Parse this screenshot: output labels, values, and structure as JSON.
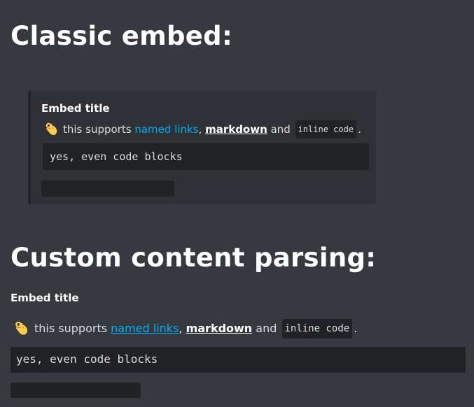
{
  "sections": {
    "classic_heading": "Classic embed:",
    "custom_heading": "Custom content parsing:"
  },
  "embed": {
    "title": "Embed title",
    "emoji_icon": "ok-hand-icon",
    "desc_prefix": "this supports ",
    "link_text": "named links",
    "comma": ",",
    "bold_text": "markdown",
    "and_text": " and ",
    "inline_code": "inline code",
    "period": ".",
    "code_block": "yes, even code blocks"
  },
  "custom": {
    "title": "Embed title",
    "emoji_icon": "ok-hand-icon",
    "desc_prefix": "this supports ",
    "link_text": "named links",
    "comma": ",",
    "bold_text": "markdown",
    "and_text": " and ",
    "inline_code": "inline code",
    "period": ".",
    "code_block": "yes, even code blocks"
  },
  "colors": {
    "background": "#36393f",
    "embed_background": "#2f3136",
    "code_background": "#202225",
    "link": "#00aff4",
    "heading": "#ffffff",
    "text": "#dcddde"
  }
}
